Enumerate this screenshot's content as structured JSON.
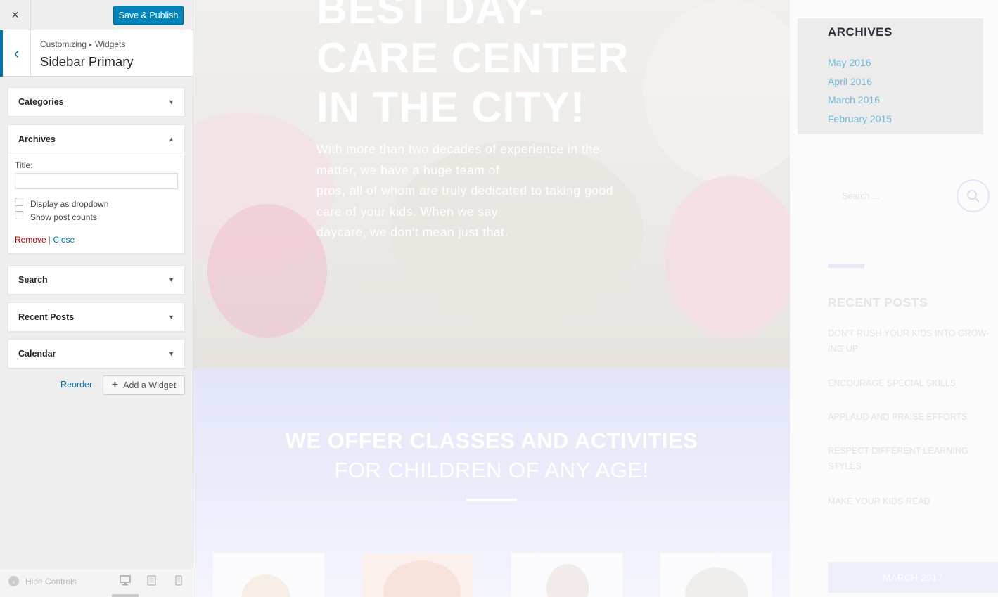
{
  "customizer": {
    "close_icon": "×",
    "publish_label": "Save & Publish",
    "back_icon": "‹",
    "breadcrumb": {
      "root": "Customizing",
      "separator": "▸",
      "current": "Widgets"
    },
    "section_title": "Sidebar Primary",
    "widgets": [
      {
        "label": "Categories",
        "state": "collapsed",
        "arrow": "▼"
      },
      {
        "label": "Archives",
        "state": "expanded",
        "arrow": "▲"
      },
      {
        "label": "Search",
        "state": "collapsed",
        "arrow": "▼"
      },
      {
        "label": "Recent Posts",
        "state": "collapsed",
        "arrow": "▼"
      },
      {
        "label": "Calendar",
        "state": "collapsed",
        "arrow": "▼"
      }
    ],
    "archives_form": {
      "title_label": "Title:",
      "title_value": "",
      "dropdown_label": "Display as dropdown",
      "dropdown_checked": false,
      "counts_label": "Show post counts",
      "counts_checked": false,
      "remove_label": "Remove",
      "divider": "|",
      "close_label": "Close"
    },
    "reorder_label": "Reorder",
    "add_widget_label": "Add a Widget",
    "add_widget_icon": "+",
    "hide_controls_label": "Hide Controls",
    "hide_controls_icon": "‹",
    "devices": [
      "desktop-icon",
      "tablet-icon",
      "mobile-icon"
    ],
    "active_device": "desktop"
  },
  "preview": {
    "hero_title_lines": [
      "BEST DAY-",
      "CARE CENTER",
      "IN THE CITY!"
    ],
    "hero_text_lines": [
      "With more than two decades of experience in the",
      "matter, we have a huge team of",
      "pros, all of whom are truly dedicated to taking good",
      "care of your kids. When we say",
      "daycare, we don't mean just that."
    ],
    "offer_heading": "WE OFFER CLASSES AND ACTIVITIES",
    "offer_subheading": "FOR CHILDREN OF ANY AGE!",
    "sidebar": {
      "archives_title": "ARCHIVES",
      "archives": [
        "May 2016",
        "April 2016",
        "March 2016",
        "February 2015"
      ],
      "search_placeholder": "Search ...",
      "search_icon": "⚲",
      "recent_posts_title": "RECENT POSTS",
      "recent_posts": [
        "DON'T RUSH YOUR KIDS INTO GROW-ING UP",
        "ENCOURAGE SPECIAL SKILLS",
        "APPLAUD AND PRAISE EFFORTS",
        "RESPECT DIFFERENT LEARNING STYLES",
        "MAKE YOUR KIDS READ"
      ],
      "calendar_month": "MARCH 2017"
    },
    "colors": {
      "accent": "#0085ba",
      "link_blue": "#0073aa",
      "remove_red": "#aa0000",
      "archive_link": "#74b9d8"
    }
  }
}
